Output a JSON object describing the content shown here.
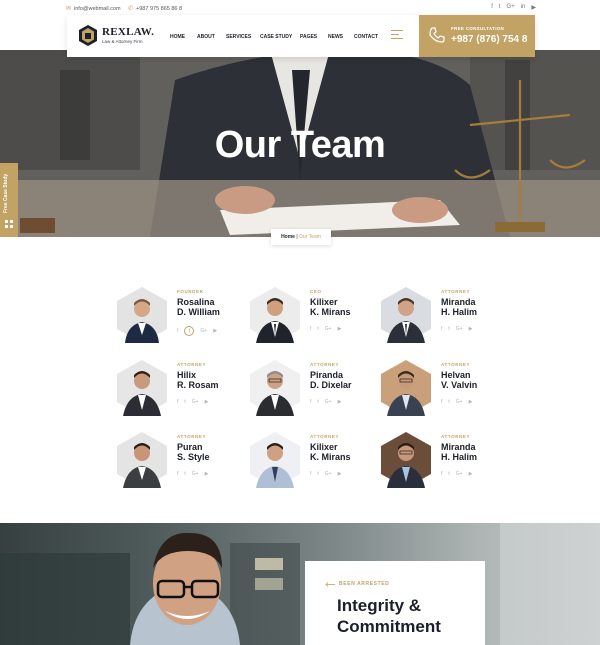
{
  "topbar": {
    "email": "info@webmail.com",
    "phone": "+987 975 865 86 8",
    "socials": [
      "f",
      "t",
      "G+",
      "in",
      "▶"
    ]
  },
  "brand": {
    "name": "REXLAW.",
    "tagline": "Law & Attorney Firm"
  },
  "nav": {
    "items": [
      "HOME",
      "ABOUT",
      "SERVICES",
      "CASE STUDY",
      "PAGES",
      "NEWS",
      "CONTACT"
    ]
  },
  "consult": {
    "label": "FREE CONSULTATION",
    "phone": "+987 (876) 754 8"
  },
  "hero": {
    "title": "Our Team"
  },
  "breadcrumb": {
    "home": "Home",
    "separator": " | ",
    "current": "Our Team"
  },
  "side_tab": {
    "label": "Free Case Study"
  },
  "team": [
    {
      "role": "FOUNDER",
      "first": "Rosalina",
      "last": "D. William"
    },
    {
      "role": "CEO",
      "first": "Kilixer",
      "last": "K. Mirans"
    },
    {
      "role": "ATTORNEY",
      "first": "Miranda",
      "last": "H. Halim"
    },
    {
      "role": "ATTORNEY",
      "first": "Hilix",
      "last": "R. Rosam"
    },
    {
      "role": "ATTORNEY",
      "first": "Piranda",
      "last": "D. Dixelar"
    },
    {
      "role": "ATTORNEY",
      "first": "Helvan",
      "last": "V. Valvin"
    },
    {
      "role": "ATTORNEY",
      "first": "Puran",
      "last": "S. Style"
    },
    {
      "role": "ATTORNEY",
      "first": "Kilixer",
      "last": "K. Mirans"
    },
    {
      "role": "ATTORNEY",
      "first": "Miranda",
      "last": "H. Halim"
    }
  ],
  "member_socials": [
    "f",
    "t",
    "G+",
    "▶"
  ],
  "about": {
    "eyebrow": "BEEN ARRESTED",
    "title_line1": "Integrity &",
    "title_line2": "Commitment"
  },
  "colors": {
    "accent": "#c3a265",
    "dark": "#1c1f2a"
  }
}
